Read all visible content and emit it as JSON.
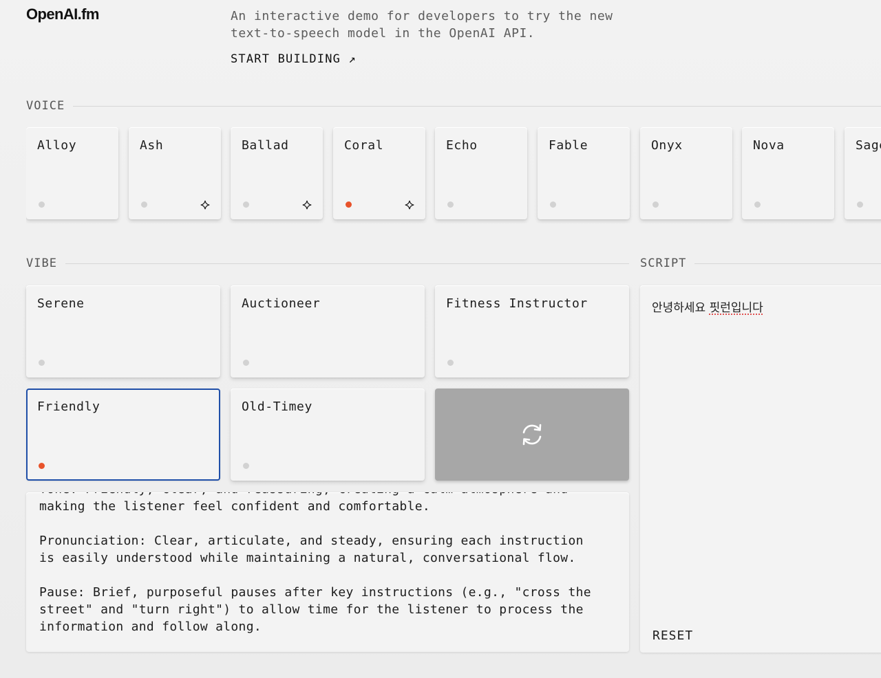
{
  "header": {
    "logo": "OpenAI.fm",
    "tagline": "An interactive demo for developers to try the new text-to-speech model in the OpenAI API.",
    "start_building": "START BUILDING ↗"
  },
  "voice": {
    "label": "VOICE",
    "items": [
      {
        "name": "Alloy",
        "active": false,
        "starred": false
      },
      {
        "name": "Ash",
        "active": false,
        "starred": true
      },
      {
        "name": "Ballad",
        "active": false,
        "starred": true
      },
      {
        "name": "Coral",
        "active": true,
        "starred": true
      },
      {
        "name": "Echo",
        "active": false,
        "starred": false
      },
      {
        "name": "Fable",
        "active": false,
        "starred": false
      },
      {
        "name": "Onyx",
        "active": false,
        "starred": false
      },
      {
        "name": "Nova",
        "active": false,
        "starred": false
      },
      {
        "name": "Sage",
        "active": false,
        "starred": false
      }
    ]
  },
  "vibe": {
    "label": "VIBE",
    "items": [
      {
        "name": "Serene",
        "active": false
      },
      {
        "name": "Auctioneer",
        "active": false
      },
      {
        "name": "Fitness Instructor",
        "active": false
      },
      {
        "name": "Friendly",
        "active": true
      },
      {
        "name": "Old-Timey",
        "active": false
      }
    ],
    "shuffle_icon": "refresh-icon",
    "instructions": "Tone: Friendly, clear, and reassuring, creating a calm atmosphere and\nmaking the listener feel confident and comfortable.\n\nPronunciation: Clear, articulate, and steady, ensuring each instruction\nis easily understood while maintaining a natural, conversational flow.\n\nPause: Brief, purposeful pauses after key instructions (e.g., \"cross the\nstreet\" and \"turn right\") to allow time for the listener to process the\ninformation and follow along.\n\nEmotion: Warm and supportive, conveying empathy and care."
  },
  "script": {
    "label": "SCRIPT",
    "text_part1": "안녕하세요 ",
    "text_part2": "핏런입니다",
    "reset_label": "RESET"
  },
  "colors": {
    "accent": "#e8532b",
    "selected_border": "#1f4fa8",
    "shuffle_bg": "#a7a7a7"
  }
}
